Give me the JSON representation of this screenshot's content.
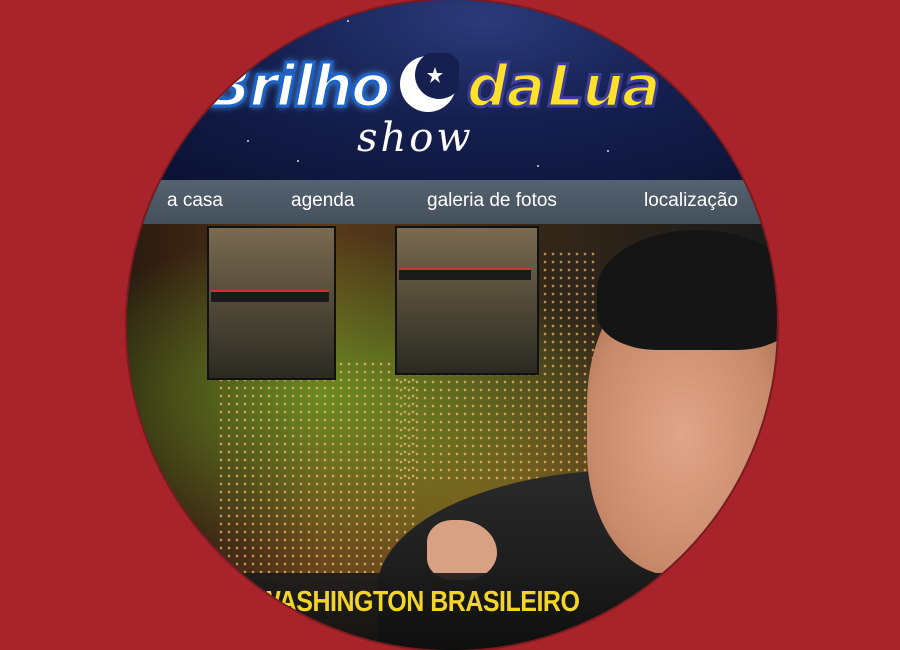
{
  "header": {
    "logo_left": "Brilho",
    "logo_mid": "da",
    "logo_right": "Lua",
    "logo_sub": "show",
    "moon_icon": "crescent-moon-star-icon"
  },
  "nav": {
    "items": [
      {
        "label": "a casa"
      },
      {
        "label": "agenda"
      },
      {
        "label": "galeria de fotos"
      },
      {
        "label": "localização"
      }
    ]
  },
  "banner": {
    "caption": "WASHINGTON BRASILEIRO"
  },
  "colors": {
    "background": "#a8242a",
    "nav": "#4d5964",
    "caption_text": "#f3d52a"
  }
}
